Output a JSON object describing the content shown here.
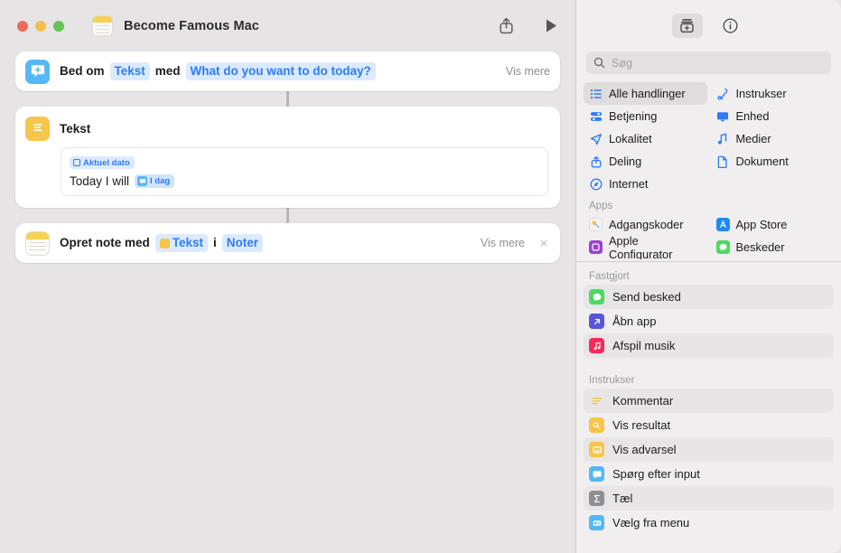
{
  "window": {
    "title": "Become Famous Mac",
    "doc_icon": "notes-document-icon",
    "traffic_lights": [
      "close",
      "minimize",
      "zoom"
    ],
    "toolbar": {
      "share_label": "share-icon",
      "run_label": "play-icon"
    }
  },
  "flow": {
    "actions": [
      {
        "id": "ask-for-input",
        "icon": "ask-for-input-icon",
        "words": [
          "Bed om",
          "med"
        ],
        "word1": "Bed om",
        "token1": "Tekst",
        "word2": "med",
        "token2": "What do you want to do today?",
        "show_more": "Vis mere"
      },
      {
        "id": "text",
        "icon": "text-action-icon",
        "title": "Tekst",
        "field": {
          "variable_chip": "Aktuel dato",
          "body": "Today I will",
          "inline_chip": "I dag"
        }
      },
      {
        "id": "create-note",
        "icon": "notes-app-icon",
        "word1": "Opret note med",
        "token1": "Tekst",
        "word2": "i",
        "token2": "Noter",
        "show_more": "Vis mere",
        "close": "×"
      }
    ]
  },
  "sidebar": {
    "toolbar": {
      "library_button": "action-library-icon",
      "info_button": "info-icon"
    },
    "search": {
      "placeholder": "Søg",
      "value": "",
      "icon": "search-icon"
    },
    "categories": [
      {
        "label": "Alle handlinger",
        "icon": "list-bullet-icon",
        "selected": true
      },
      {
        "label": "Instrukser",
        "icon": "scripting-icon",
        "selected": false
      },
      {
        "label": "Betjening",
        "icon": "controls-icon",
        "selected": false
      },
      {
        "label": "Enhed",
        "icon": "display-icon",
        "selected": false
      },
      {
        "label": "Lokalitet",
        "icon": "location-arrow-icon",
        "selected": false
      },
      {
        "label": "Medier",
        "icon": "music-note-icon",
        "selected": false
      },
      {
        "label": "Deling",
        "icon": "share-up-icon",
        "selected": false
      },
      {
        "label": "Dokument",
        "icon": "document-icon",
        "selected": false
      },
      {
        "label": "Internet",
        "icon": "safari-compass-icon",
        "selected": false
      }
    ],
    "apps_header": "Apps",
    "apps": [
      {
        "label": "Adgangskoder",
        "icon": "passwords-app-icon",
        "color": "#f2f2f5"
      },
      {
        "label": "App Store",
        "icon": "app-store-icon",
        "color": "#1f8bf0"
      },
      {
        "label": "Apple Configurator",
        "icon": "apple-configurator-icon",
        "color": "#9b3fd4"
      },
      {
        "label": "Beskeder",
        "icon": "messages-app-icon",
        "color": "#4cd964"
      }
    ],
    "pinned_header": "Fastgjort",
    "pinned": [
      {
        "label": "Send besked",
        "icon": "messages-icon",
        "color": "#4cd964"
      },
      {
        "label": "Åbn app",
        "icon": "open-app-icon",
        "color": "#5856d6"
      },
      {
        "label": "Afspil musik",
        "icon": "music-app-icon",
        "color": "#f8295b"
      }
    ],
    "scripting_header": "Instrukser",
    "scripting": [
      {
        "label": "Kommentar",
        "icon": "comment-icon",
        "color": "#f6c54a"
      },
      {
        "label": "Vis resultat",
        "icon": "show-result-icon",
        "color": "#f6c54a"
      },
      {
        "label": "Vis advarsel",
        "icon": "show-alert-icon",
        "color": "#f6c54a"
      },
      {
        "label": "Spørg efter input",
        "icon": "ask-input-icon",
        "color": "#55b8f5"
      },
      {
        "label": "Tæl",
        "icon": "count-sigma-icon",
        "color": "#8e8e93"
      },
      {
        "label": "Vælg fra menu",
        "icon": "choose-menu-icon",
        "color": "#55b8f5"
      }
    ]
  },
  "colors": {
    "accent_blue": "#2d7cf6",
    "token_bg": "#dbeaff",
    "canvas": "#e6e4e4",
    "sidebar": "#f0eeee",
    "card": "#ffffff"
  }
}
